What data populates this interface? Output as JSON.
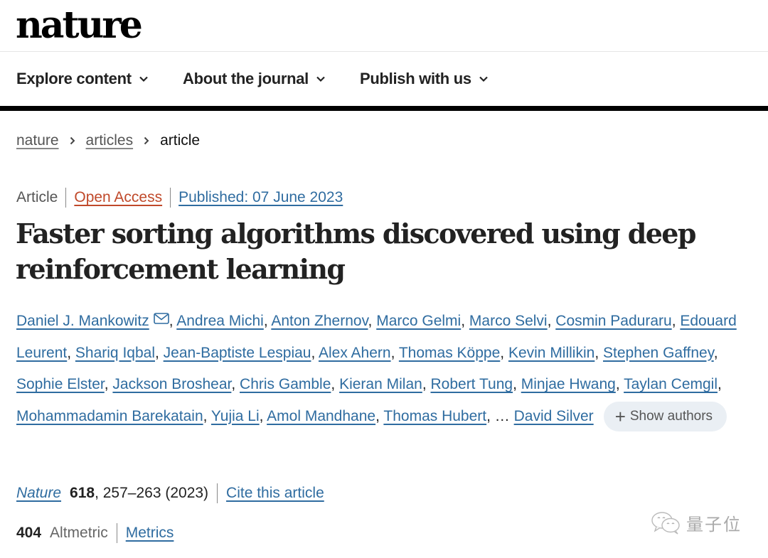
{
  "header": {
    "logo": "nature",
    "nav": [
      {
        "label": "Explore content"
      },
      {
        "label": "About the journal"
      },
      {
        "label": "Publish with us"
      }
    ]
  },
  "breadcrumb": {
    "items": [
      {
        "label": "nature"
      },
      {
        "label": "articles"
      }
    ],
    "current": "article"
  },
  "article": {
    "type": "Article",
    "access": "Open Access",
    "published": "Published: 07 June 2023",
    "title": "Faster sorting algorithms discovered using deep reinforcement learning",
    "authors": [
      "Daniel J. Mankowitz",
      "Andrea Michi",
      "Anton Zhernov",
      "Marco Gelmi",
      "Marco Selvi",
      "Cosmin Paduraru",
      "Edouard Leurent",
      "Shariq Iqbal",
      "Jean-Baptiste Lespiau",
      "Alex Ahern",
      "Thomas Köppe",
      "Kevin Millikin",
      "Stephen Gaffney",
      "Sophie Elster",
      "Jackson Broshear",
      "Chris Gamble",
      "Kieran Milan",
      "Robert Tung",
      "Minjae Hwang",
      "Taylan Cemgil",
      "Mohammadamin Barekatain",
      "Yujia Li",
      "Amol Mandhane",
      "Thomas Hubert"
    ],
    "ellipsis": "…",
    "last_author": "David Silver",
    "show_authors_label": "Show authors",
    "citation": {
      "journal": "Nature",
      "volume": "618",
      "pages_year": ", 257–263 (2023)",
      "cite_label": "Cite this article"
    },
    "metrics": {
      "altmetric_count": "404",
      "altmetric_label": "Altmetric",
      "metrics_label": "Metrics"
    }
  },
  "watermark": {
    "text": "量子位",
    "icon": "wechat-icon"
  },
  "colors": {
    "link": "#2f6ca0",
    "open_access": "#c0492a",
    "show_authors_bg": "#eaeff4"
  }
}
